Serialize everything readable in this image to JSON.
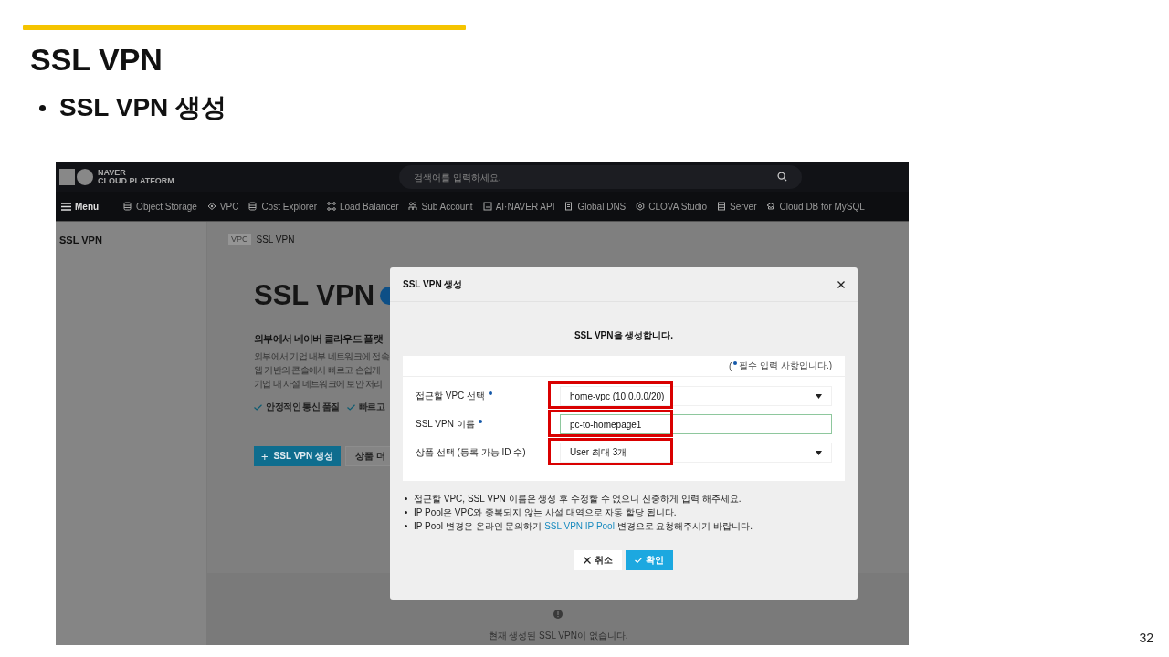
{
  "slide": {
    "title": "SSL VPN",
    "bullet": "SSL VPN 생성",
    "page_number": "32"
  },
  "screenshot": {
    "header": {
      "logo_line1": "NAVER",
      "logo_line2": "CLOUD PLATFORM",
      "search_placeholder": "검색어를 입력하세요."
    },
    "nav": {
      "menu_label": "Menu",
      "items": [
        {
          "label": "Object Storage"
        },
        {
          "label": "VPC"
        },
        {
          "label": "Cost Explorer"
        },
        {
          "label": "Load Balancer"
        },
        {
          "label": "Sub Account"
        },
        {
          "label": "AI·NAVER API"
        },
        {
          "label": "Global DNS"
        },
        {
          "label": "CLOVA Studio"
        },
        {
          "label": "Server"
        },
        {
          "label": "Cloud DB for MySQL"
        }
      ]
    },
    "sidebar": {
      "title": "SSL VPN"
    },
    "breadcrumb": {
      "tag": "VPC",
      "label": "SSL VPN"
    },
    "product": {
      "title": "SSL VPN",
      "heading": "외부에서 네이버 클라우드 플랫",
      "description": [
        "외부에서 기업 내부 네트워크에 접속",
        "웹 기반의 콘솔에서 빠르고 손쉽게",
        "기업 내 사설 네트워크에 보안 처리"
      ],
      "features": [
        "안정적인 통신 품질",
        "빠르고"
      ],
      "primary_button_icon": "+",
      "primary_button": "SSL VPN 생성",
      "secondary_button": "상품 더"
    },
    "empty_state": {
      "message": "현재 생성된 SSL VPN이 없습니다."
    },
    "modal": {
      "title": "SSL VPN 생성",
      "subtitle": "SSL VPN을 생성합니다.",
      "required_note_open": "(",
      "required_note": "필수 입력 사항입니다.)",
      "fields": [
        {
          "kind": "select",
          "label": "접근할 VPC 선택",
          "required": true,
          "value": "home-vpc (10.0.0.0/20)",
          "focused": false,
          "highlighted": true
        },
        {
          "kind": "text",
          "label": "SSL VPN 이름",
          "required": true,
          "value": "pc-to-homepage1",
          "focused": true,
          "highlighted": true
        },
        {
          "kind": "select",
          "label": "상품 선택 (등록 가능 ID 수)",
          "required": false,
          "value": "User 최대 3개",
          "focused": false,
          "highlighted": true
        }
      ],
      "notes": [
        {
          "before": "접근할 VPC, SSL VPN 이름은 생성 후 수정할 수 없으니 신중하게 입력 해주세요."
        },
        {
          "before": "IP Pool은 VPC와 중복되지 않는 사설 대역으로 자동 할당 됩니다."
        },
        {
          "before": "IP Pool 변경은 온라인 문의하기 ",
          "link": "SSL VPN IP Pool",
          "after": " 변경으로 요청해주시기 바랍니다."
        }
      ],
      "cancel_button": "취소",
      "confirm_button": "확인"
    }
  }
}
